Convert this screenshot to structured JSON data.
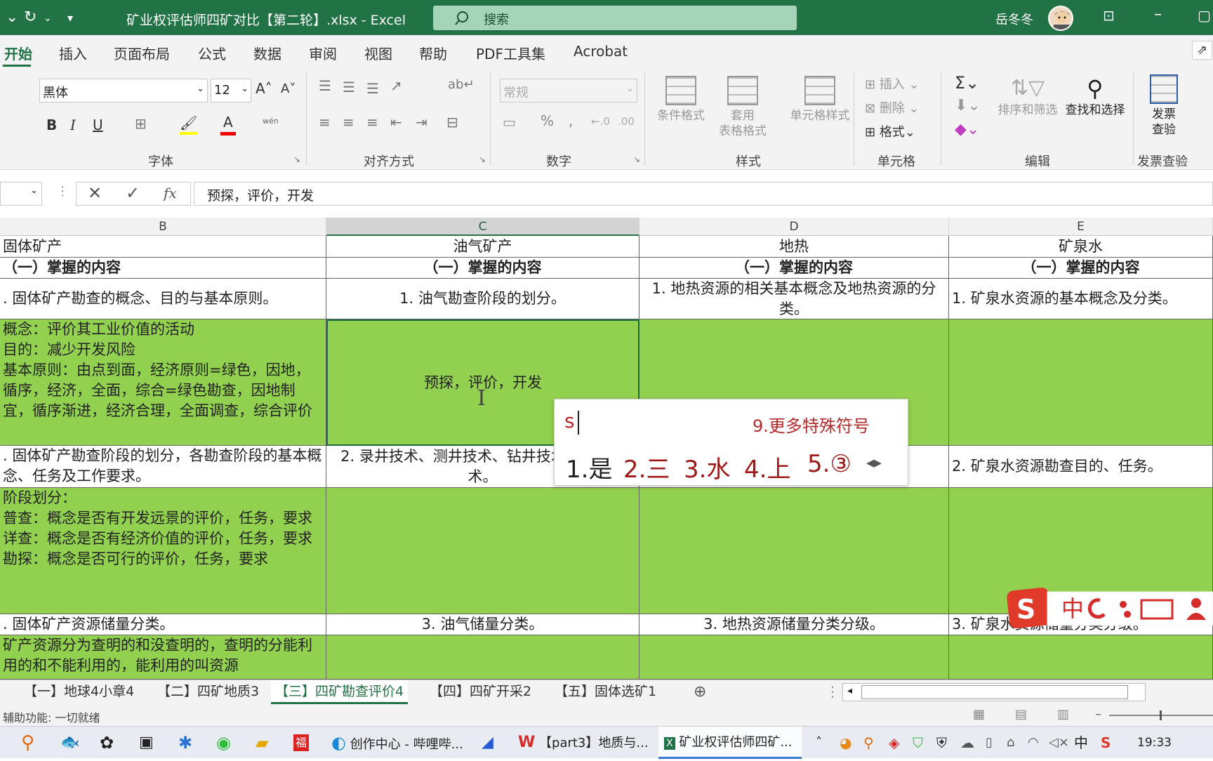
{
  "window": {
    "title": "矿业权评估师四矿对比【第二轮】.xlsx  -  Excel",
    "search_placeholder": "搜索",
    "user_name": "岳冬冬"
  },
  "ribbon_tabs": [
    "开始",
    "插入",
    "页面布局",
    "公式",
    "数据",
    "审阅",
    "视图",
    "帮助",
    "PDF工具集",
    "Acrobat"
  ],
  "ribbon": {
    "font_name": "黑体",
    "font_size": "12",
    "number_format": "常规",
    "groups": {
      "font": "字体",
      "alignment": "对齐方式",
      "number": "数字",
      "styles": "样式",
      "cells": "单元格",
      "editing": "编辑",
      "invoice": "发票查验"
    },
    "buttons": {
      "conditional_format": "条件格式",
      "format_as_table_1": "套用",
      "format_as_table_2": "表格格式",
      "cell_styles": "单元格样式",
      "insert": "插入",
      "delete": "删除",
      "format": "格式",
      "sort_filter": "排序和筛选",
      "find_select": "查找和选择",
      "invoice_check_1": "发票",
      "invoice_check_2": "查验",
      "bold": "B",
      "italic": "I",
      "underline": "U",
      "wen": "wén"
    }
  },
  "formula_bar": {
    "content": "预探，评价，开发"
  },
  "columns": [
    "B",
    "C",
    "D",
    "E"
  ],
  "rows": {
    "r1": [
      "固体矿产",
      "油气矿产",
      "地热",
      "矿泉水"
    ],
    "r2": [
      "（一）掌握的内容",
      "（一）掌握的内容",
      "（一）掌握的内容",
      "（一）掌握的内容"
    ],
    "r3": [
      ". 固体矿产勘查的概念、目的与基本原则。",
      "1. 油气勘查阶段的划分。",
      "1. 地热资源的相关基本概念及地热资源的分类。",
      "1. 矿泉水资源的基本概念及分类。"
    ],
    "r4": [
      "概念：评价其工业价值的活动\n目的：减少开发风险\n基本原则：由点到面，经济原则=绿色，因地，循序，经济，全面，综合=绿色勘查，因地制宜，循序渐进，经济合理，全面调查，综合评价",
      "预探，评价，开发",
      "",
      ""
    ],
    "r5": [
      ". 固体矿产勘查阶段的划分，各勘查阶段的基本概念、任务及工作要求。",
      "2. 录井技术、测井技术、钻井技术、试油技术。",
      "",
      "2. 矿泉水资源勘查目的、任务。"
    ],
    "r6": [
      "阶段划分：\n普查：概念是否有开发远景的评价，任务，要求\n详查：概念是否有经济价值的评价，任务，要求\n勘探：概念是否可行的评价，任务，要求",
      "",
      "",
      ""
    ],
    "r7": [
      ". 固体矿产资源储量分类。",
      "3. 油气储量分类。",
      "3. 地热资源储量分类分级。",
      "3. 矿泉水资源储量分类分级。"
    ],
    "r8": [
      "矿产资源分为查明的和没查明的，查明的分能利用的和不能利用的，能利用的叫资源",
      "",
      "",
      ""
    ]
  },
  "sheet_tabs": [
    "【一】地球4小章4",
    "【二】四矿地质3",
    "【三】四矿勘查评价4",
    "【四】四矿开采2",
    "【五】固体选矿1"
  ],
  "status_text": "辅助功能: 一切就绪",
  "ime": {
    "input": "s",
    "more": "9.更多特殊符号",
    "candidates": [
      "1.是",
      "2.三",
      "3.水",
      "4.上",
      "5.③"
    ]
  },
  "taskbar": {
    "items": [
      "创作中心 - 哔哩哔...",
      "【part3】地质与...",
      "矿业权评估师四矿..."
    ],
    "ime_mode": "中",
    "time": "19:33"
  },
  "colors": {
    "excel_green": "#217346",
    "cell_green": "#92d050",
    "ime_red": "#b52a2a"
  }
}
